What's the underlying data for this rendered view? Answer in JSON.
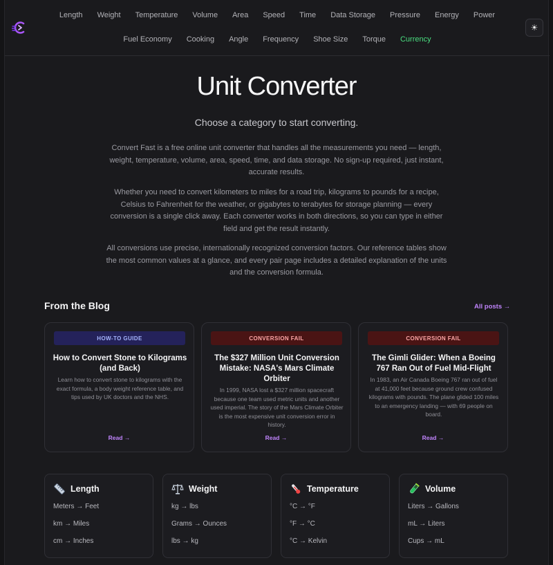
{
  "nav": {
    "row1": [
      "Length",
      "Weight",
      "Temperature",
      "Volume",
      "Area",
      "Speed",
      "Time",
      "Data Storage",
      "Pressure",
      "Energy",
      "Power"
    ],
    "row2": [
      "Fuel Economy",
      "Cooking",
      "Angle",
      "Frequency",
      "Shoe Size",
      "Torque",
      "Currency"
    ],
    "active": "Currency"
  },
  "theme_toggle": {
    "icon": "sun-icon",
    "glyph": "☀"
  },
  "hero": {
    "title": "Unit Converter",
    "subtitle": "Choose a category to start converting.",
    "paragraphs": [
      "Convert Fast is a free online unit converter that handles all the measurements you need — length, weight, temperature, volume, area, speed, time, and data storage. No sign-up required, just instant, accurate results.",
      "Whether you need to convert kilometers to miles for a road trip, kilograms to pounds for a recipe, Celsius to Fahrenheit for the weather, or gigabytes to terabytes for storage planning — every conversion is a single click away. Each converter works in both directions, so you can type in either field and get the result instantly.",
      "All conversions use precise, internationally recognized conversion factors. Our reference tables show the most common values at a glance, and every pair page includes a detailed explanation of the units and the conversion formula."
    ]
  },
  "blog": {
    "heading": "From the Blog",
    "all_posts": "All posts →",
    "posts": [
      {
        "badge": "HOW-TO GUIDE",
        "title": "How to Convert Stone to Kilograms (and Back)",
        "excerpt": "Learn how to convert stone to kilograms with the exact formula, a body weight reference table, and tips used by UK doctors and the NHS.",
        "read": "Read →"
      },
      {
        "badge": "CONVERSION FAIL",
        "title": "The $327 Million Unit Conversion Mistake: NASA's Mars Climate Orbiter",
        "excerpt": "In 1999, NASA lost a $327 million spacecraft because one team used metric units and another used imperial. The story of the Mars Climate Orbiter is the most expensive unit conversion error in history.",
        "read": "Read →"
      },
      {
        "badge": "CONVERSION FAIL",
        "title": "The Gimli Glider: When a Boeing 767 Ran Out of Fuel Mid-Flight",
        "excerpt": "In 1983, an Air Canada Boeing 767 ran out of fuel at 41,000 feet because ground crew confused kilograms with pounds. The plane glided 100 miles to an emergency landing — with 69 people on board.",
        "read": "Read →"
      }
    ]
  },
  "categories": [
    {
      "title": "Length",
      "icon": "ruler-icon",
      "links": [
        "Meters → Feet",
        "km → Miles",
        "cm → Inches"
      ]
    },
    {
      "title": "Weight",
      "icon": "scale-icon",
      "links": [
        "kg → lbs",
        "Grams → Ounces",
        "lbs → kg"
      ]
    },
    {
      "title": "Temperature",
      "icon": "thermometer-icon",
      "links": [
        "°C → °F",
        "°F → °C",
        "°C → Kelvin"
      ]
    },
    {
      "title": "Volume",
      "icon": "test-tube-icon",
      "links": [
        "Liters → Gallons",
        "mL → Liters",
        "Cups → mL"
      ]
    }
  ],
  "colors": {
    "accent_green": "#4ade80",
    "accent_purple": "#c084fc",
    "guide_badge_bg": "#24225a",
    "fail_badge_bg": "#4a1414"
  }
}
